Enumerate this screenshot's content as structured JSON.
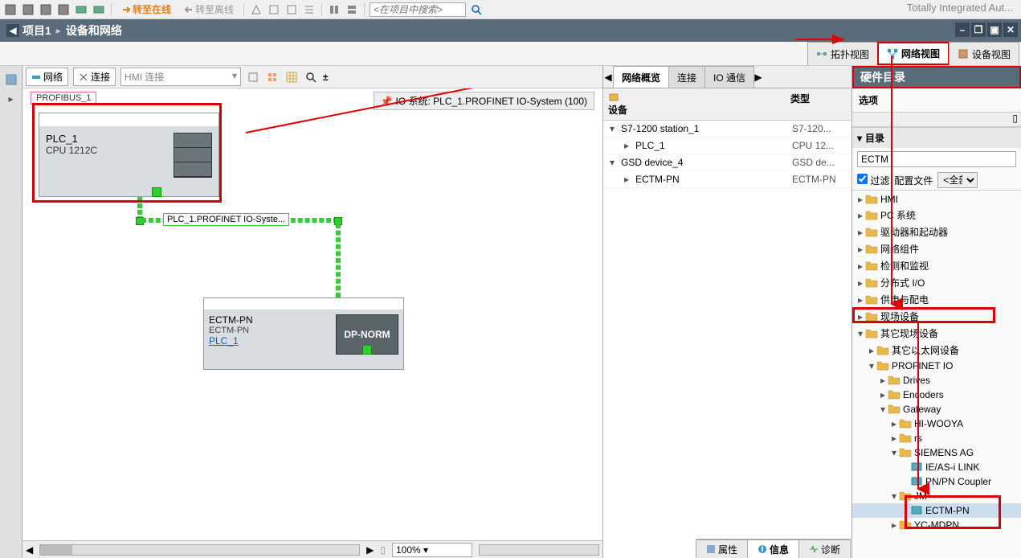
{
  "top_right_text": "Totally Integrated Aut...",
  "toolbar": {
    "go_online": "转至在线",
    "go_offline": "转至离线",
    "search_placeholder": "<在项目中搜索>"
  },
  "breadcrumb": {
    "project": "项目1",
    "page": "设备和网络"
  },
  "view_tabs": {
    "topology": "拓扑视图",
    "network": "网络视图",
    "device": "设备视图"
  },
  "center_toolbar": {
    "network_btn": "网络",
    "connect_btn": "连接",
    "hmi_dropdown": "HMI 连接"
  },
  "canvas": {
    "profibus_label": "PROFIBUS_1",
    "io_system_label": "IO 系统: PLC_1.PROFINET IO-System (100)",
    "plc": {
      "name": "PLC_1",
      "cpu": "CPU 1212C"
    },
    "conn_label": "PLC_1.PROFINET IO-Syste...",
    "ectm": {
      "name": "ECTM-PN",
      "sub": "ECTM-PN",
      "link": "PLC_1",
      "module": "DP-NORM"
    }
  },
  "zoom": "100%",
  "right_panel": {
    "tabs": {
      "overview": "网络概览",
      "connections": "连接",
      "io_comm": "IO 通信"
    },
    "cols": {
      "device": "设备",
      "type": "类型"
    },
    "rows": [
      {
        "indent": 0,
        "exp": "▾",
        "name": "S7-1200 station_1",
        "type": "S7-120..."
      },
      {
        "indent": 1,
        "exp": "▸",
        "name": "PLC_1",
        "type": "CPU 12..."
      },
      {
        "indent": 0,
        "exp": "▾",
        "name": "GSD device_4",
        "type": "GSD de..."
      },
      {
        "indent": 1,
        "exp": "▸",
        "name": "ECTM-PN",
        "type": "ECTM-PN"
      }
    ]
  },
  "catalog": {
    "title": "硬件目录",
    "options": "选项",
    "section": "目录",
    "search_value": "ECTM",
    "filter_label": "过滤",
    "profile_label": "配置文件",
    "profile_value": "<全部>",
    "tree": [
      {
        "d": 0,
        "exp": "▸",
        "label": "HMI"
      },
      {
        "d": 0,
        "exp": "▸",
        "label": "PC 系统"
      },
      {
        "d": 0,
        "exp": "▸",
        "label": "驱动器和起动器"
      },
      {
        "d": 0,
        "exp": "▸",
        "label": "网络组件"
      },
      {
        "d": 0,
        "exp": "▸",
        "label": "检测和监视"
      },
      {
        "d": 0,
        "exp": "▸",
        "label": "分布式 I/O"
      },
      {
        "d": 0,
        "exp": "▸",
        "label": "供电与配电"
      },
      {
        "d": 0,
        "exp": "▸",
        "label": "现场设备"
      },
      {
        "d": 0,
        "exp": "▾",
        "label": "其它现场设备",
        "hl": true
      },
      {
        "d": 1,
        "exp": "▸",
        "label": "其它以太网设备"
      },
      {
        "d": 1,
        "exp": "▾",
        "label": "PROFINET IO"
      },
      {
        "d": 2,
        "exp": "▸",
        "label": "Drives"
      },
      {
        "d": 2,
        "exp": "▸",
        "label": "Encoders"
      },
      {
        "d": 2,
        "exp": "▾",
        "label": "Gateway"
      },
      {
        "d": 3,
        "exp": "▸",
        "label": "HI-WOOYA"
      },
      {
        "d": 3,
        "exp": "▸",
        "label": "rs"
      },
      {
        "d": 3,
        "exp": "▾",
        "label": "SIEMENS AG"
      },
      {
        "d": 4,
        "exp": "",
        "label": "IE/AS-i LINK",
        "leaf": true
      },
      {
        "d": 4,
        "exp": "",
        "label": "PN/PN Coupler",
        "leaf": true
      },
      {
        "d": 3,
        "exp": "▾",
        "label": "JM",
        "hl": true
      },
      {
        "d": 4,
        "exp": "",
        "label": "ECTM-PN",
        "leaf": true,
        "sel": true,
        "hl": true
      },
      {
        "d": 3,
        "exp": "▸",
        "label": "YC-MDPN"
      }
    ]
  },
  "bottom_tabs": {
    "properties": "属性",
    "info": "信息",
    "diagnostics": "诊断"
  }
}
